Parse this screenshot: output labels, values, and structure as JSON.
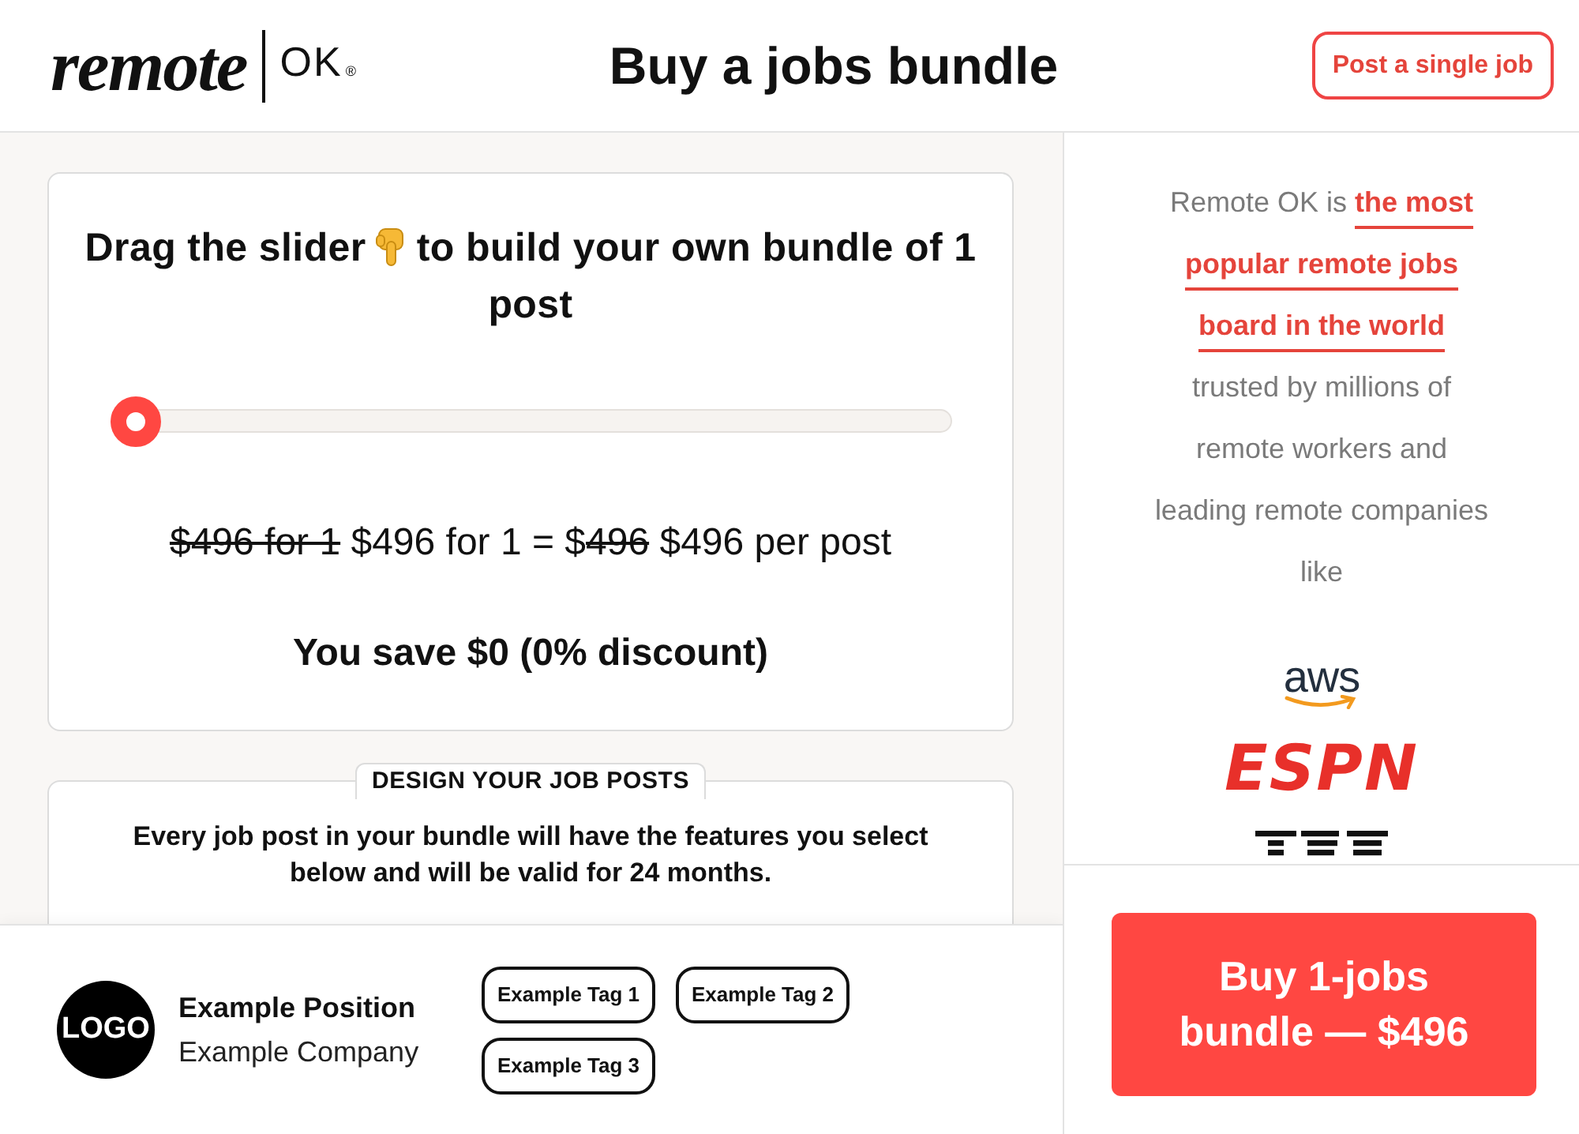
{
  "header": {
    "logo": {
      "wordmark": "remote",
      "mark": "OK",
      "registered": "®"
    },
    "title": "Buy a jobs bundle",
    "action_button": "Post a single job"
  },
  "bundle": {
    "heading_before": "Drag the slider",
    "heading_after": "to build your own bundle of 1 post",
    "slider": {
      "level": 0
    },
    "price_line": [
      {
        "text": "$496 for 1",
        "struck": true
      },
      {
        "text": " $496 for 1 = $",
        "struck": false
      },
      {
        "text": "496",
        "struck": true
      },
      {
        "text": " $496 per post",
        "struck": false
      }
    ],
    "savings": "You save $0 (0% discount)"
  },
  "design": {
    "legend": "DESIGN YOUR JOB POSTS",
    "description": "Every job post in your bundle will have the features you select below and will be valid for 24 months."
  },
  "preview": {
    "logo_text": "LOGO",
    "position": "Example Position",
    "company": "Example Company",
    "tags": [
      "Example Tag 1",
      "Example Tag 2",
      "Example Tag 3"
    ]
  },
  "sidebar": {
    "pitch": "Remote OK is **the most popular remote jobs board in the world** trusted by millions of remote workers and leading remote companies like",
    "companies": [
      {
        "kind": "aws",
        "name": "aws"
      },
      {
        "kind": "espn",
        "name": "ESPN"
      },
      {
        "kind": "striped"
      }
    ]
  },
  "buy_button": "Buy 1-jobs bundle — $496"
}
